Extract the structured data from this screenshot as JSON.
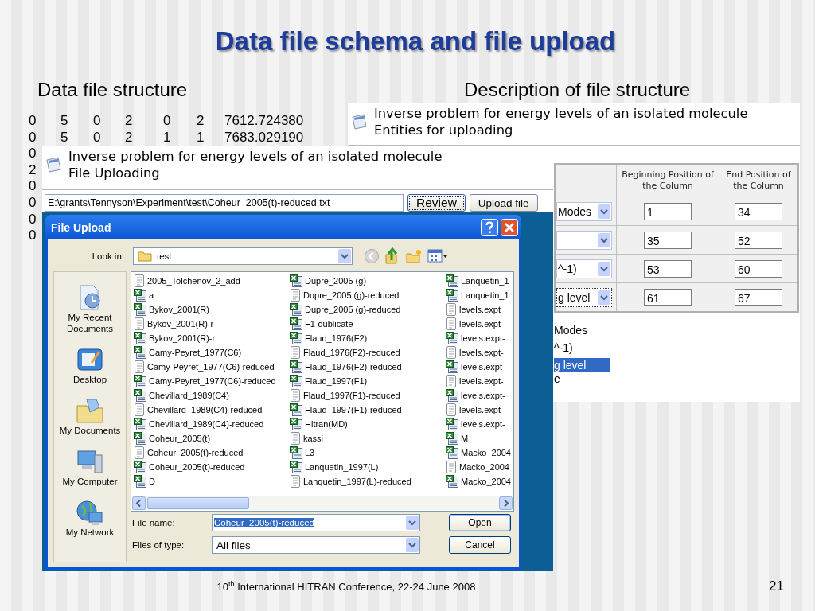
{
  "slide": {
    "title": "Data file schema and file upload",
    "left_heading": "Data file structure",
    "right_heading": "Description of file structure",
    "footer": "10$^{th}$ International HITRAN Conference, 22-24 June 2008",
    "page_number": "21"
  },
  "data_rows": [
    {
      "values": [
        "0",
        "5",
        "0",
        "2",
        "0",
        "2",
        "7612.724380"
      ]
    },
    {
      "values": [
        "0",
        "5",
        "0",
        "2",
        "1",
        "1",
        "7683.029190"
      ]
    },
    {
      "values": [
        "0"
      ]
    },
    {
      "values": [
        "2"
      ]
    },
    {
      "values": [
        "0"
      ]
    },
    {
      "values": [
        "0"
      ]
    },
    {
      "values": [
        "0"
      ]
    },
    {
      "values": [
        "0"
      ]
    }
  ],
  "entities_window": {
    "title_lines": [
      "Inverse problem for energy levels of an isolated molecule",
      "Entities for uploading"
    ],
    "columns": [
      "Beginning Position of the Column",
      "End Position of the Column"
    ],
    "rows": [
      {
        "type_value": "Modes",
        "begin": "1",
        "end": "34",
        "focused": false
      },
      {
        "begin": "35",
        "end": "52",
        "focused": false
      },
      {
        "type_value": "^-1)",
        "begin": "53",
        "end": "60",
        "focused": false
      },
      {
        "type_value": "g level",
        "begin": "61",
        "end": "67",
        "focused": true
      }
    ],
    "dropdown": [
      {
        "label": "Modes",
        "selected": false
      },
      {
        "label": "^-1)",
        "selected": false
      },
      {
        "label": "g level",
        "selected": true
      },
      {
        "label": "e",
        "selected": false
      }
    ]
  },
  "upload_window": {
    "title_lines": [
      "Inverse problem for energy levels of an isolated molecule",
      "File Uploading"
    ],
    "file_path": "E:\\grants\\Tennyson\\Experiment\\test\\Coheur_2005(t)-reduced.txt",
    "buttons": [
      {
        "label": "Review",
        "focused": true
      },
      {
        "label": "Upload file",
        "focused": false
      }
    ]
  },
  "dialog": {
    "title": "File Upload",
    "look_in_label": "Look in:",
    "look_in_value": "test",
    "places": [
      {
        "label": "My Recent Documents",
        "kind": "recent"
      },
      {
        "label": "Desktop",
        "kind": "desktop"
      },
      {
        "label": "My Documents",
        "kind": "documents"
      },
      {
        "label": "My Computer",
        "kind": "computer"
      },
      {
        "label": "My Network",
        "kind": "network"
      }
    ],
    "files": [
      {
        "name": "2005_Tolchenov_2_add",
        "kind": "text"
      },
      {
        "name": "a",
        "kind": "sheet"
      },
      {
        "name": "Bykov_2001(R)",
        "kind": "sheet"
      },
      {
        "name": "Bykov_2001(R)-r",
        "kind": "text"
      },
      {
        "name": "Bykov_2001(R)-r",
        "kind": "sheet"
      },
      {
        "name": "Camy-Peyret_1977(C6)",
        "kind": "sheet"
      },
      {
        "name": "Camy-Peyret_1977(C6)-reduced",
        "kind": "text"
      },
      {
        "name": "Camy-Peyret_1977(C6)-reduced",
        "kind": "sheet"
      },
      {
        "name": "Chevillard_1989(C4)",
        "kind": "sheet"
      },
      {
        "name": "Chevillard_1989(C4)-reduced",
        "kind": "text"
      },
      {
        "name": "Chevillard_1989(C4)-reduced",
        "kind": "sheet"
      },
      {
        "name": "Coheur_2005(t)",
        "kind": "sheet"
      },
      {
        "name": "Coheur_2005(t)-reduced",
        "kind": "text"
      },
      {
        "name": "Coheur_2005(t)-reduced",
        "kind": "sheet"
      },
      {
        "name": "D",
        "kind": "sheet"
      },
      {
        "name": "Dupre_2005 (g)",
        "kind": "sheet"
      },
      {
        "name": "Dupre_2005 (g)-reduced",
        "kind": "text"
      },
      {
        "name": "Dupre_2005 (g)-reduced",
        "kind": "sheet"
      },
      {
        "name": "F1-dublicate",
        "kind": "sheet"
      },
      {
        "name": "Flaud_1976(F2)",
        "kind": "sheet"
      },
      {
        "name": "Flaud_1976(F2)-reduced",
        "kind": "text"
      },
      {
        "name": "Flaud_1976(F2)-reduced",
        "kind": "sheet"
      },
      {
        "name": "Flaud_1997(F1)",
        "kind": "sheet"
      },
      {
        "name": "Flaud_1997(F1)-reduced",
        "kind": "text"
      },
      {
        "name": "Flaud_1997(F1)-reduced",
        "kind": "sheet"
      },
      {
        "name": "Hitran(MD)",
        "kind": "sheet"
      },
      {
        "name": "kassi",
        "kind": "text"
      },
      {
        "name": "L3",
        "kind": "sheet"
      },
      {
        "name": "Lanquetin_1997(L)",
        "kind": "sheet"
      },
      {
        "name": "Lanquetin_1997(L)-reduced",
        "kind": "text"
      },
      {
        "name": "Lanquetin_1",
        "kind": "sheet"
      },
      {
        "name": "Lanquetin_1",
        "kind": "sheet"
      },
      {
        "name": "levels.expt",
        "kind": "text"
      },
      {
        "name": "levels.expt-",
        "kind": "text"
      },
      {
        "name": "levels.expt-",
        "kind": "sheet"
      },
      {
        "name": "levels.expt-",
        "kind": "text"
      },
      {
        "name": "levels.expt-",
        "kind": "sheet"
      },
      {
        "name": "levels.expt-",
        "kind": "text"
      },
      {
        "name": "levels.expt-",
        "kind": "sheet"
      },
      {
        "name": "levels.expt-",
        "kind": "text"
      },
      {
        "name": "levels.expt-",
        "kind": "sheet"
      },
      {
        "name": "M",
        "kind": "sheet"
      },
      {
        "name": "Macko_2004",
        "kind": "sheet"
      },
      {
        "name": "Macko_2004",
        "kind": "text"
      },
      {
        "name": "Macko_2004",
        "kind": "sheet"
      }
    ],
    "file_name_label": "File name:",
    "file_name": "Coheur_2005(t)-reduced",
    "file_type_label": "Files of type:",
    "file_type": "All files",
    "buttons": [
      "Open",
      "Cancel"
    ]
  }
}
